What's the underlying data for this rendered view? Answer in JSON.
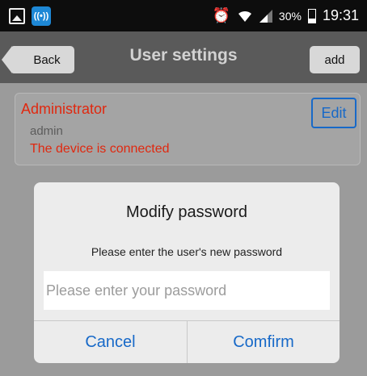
{
  "status_bar": {
    "battery_percent": "30%",
    "time": "19:31",
    "icons": [
      "gallery-icon",
      "hotspot-icon",
      "alarm-icon",
      "wifi-icon",
      "signal-icon",
      "battery-icon"
    ]
  },
  "header": {
    "back_label": "Back",
    "title": "User settings",
    "add_label": "add"
  },
  "user_card": {
    "name": "Administrator",
    "account": "admin",
    "status": "The device is connected",
    "edit_label": "Edit"
  },
  "dialog": {
    "title": "Modify password",
    "message": "Please enter the user's new password",
    "input_value": "",
    "input_placeholder": "Please enter your password",
    "cancel_label": "Cancel",
    "confirm_label": "Comfirm"
  },
  "colors": {
    "accent": "#1769c8",
    "alert": "#e0280f",
    "header_bg": "#5a5a5a",
    "overlay_bg": "#9b9b9b"
  }
}
